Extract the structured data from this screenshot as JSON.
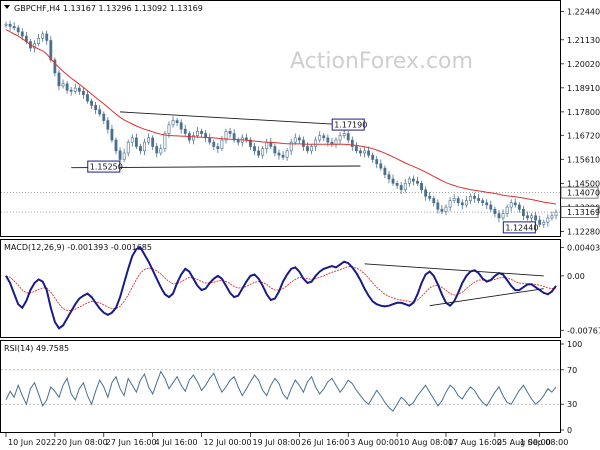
{
  "chart_data": [
    {
      "type": "candlestick",
      "title": "GBPCHF,H4  1.13167 1.13296 1.13092 1.13169",
      "watermark": "ActionForex.com",
      "y_ticks": [
        "1.22440",
        "1.21130",
        "1.20020",
        "1.18910",
        "1.17800",
        "1.16720",
        "1.15610",
        "1.14500",
        "1.13390",
        "1.12280"
      ],
      "ylim": [
        1.1225,
        1.226
      ],
      "price_tags": [
        "1.14070",
        "1.13169"
      ],
      "price_tag_values": [
        1.1407,
        1.13169
      ],
      "annotations": [
        {
          "text": "1.17190",
          "x_index": 84,
          "y": 1.1719
        },
        {
          "text": "1.15250",
          "x_index": 24,
          "y": 1.1525
        },
        {
          "text": "1.12440",
          "x_index": 126,
          "y": 1.1244
        }
      ],
      "ma_color": "#e03030",
      "candle_color": "#4a6f8f",
      "closes": [
        1.2185,
        1.2175,
        1.2168,
        1.215,
        1.213,
        1.2105,
        1.2075,
        1.2095,
        1.212,
        1.214,
        1.211,
        1.202,
        1.196,
        1.19,
        1.191,
        1.188,
        1.1875,
        1.189,
        1.1875,
        1.186,
        1.183,
        1.181,
        1.179,
        1.177,
        1.174,
        1.17,
        1.165,
        1.16,
        1.156,
        1.159,
        1.164,
        1.166,
        1.162,
        1.16,
        1.164,
        1.166,
        1.162,
        1.159,
        1.161,
        1.168,
        1.172,
        1.174,
        1.173,
        1.17,
        1.168,
        1.165,
        1.167,
        1.169,
        1.168,
        1.166,
        1.164,
        1.162,
        1.161,
        1.165,
        1.169,
        1.168,
        1.165,
        1.164,
        1.166,
        1.165,
        1.162,
        1.16,
        1.158,
        1.161,
        1.164,
        1.162,
        1.159,
        1.158,
        1.157,
        1.16,
        1.164,
        1.166,
        1.165,
        1.162,
        1.16,
        1.162,
        1.165,
        1.167,
        1.166,
        1.164,
        1.163,
        1.165,
        1.167,
        1.168,
        1.165,
        1.162,
        1.16,
        1.159,
        1.16,
        1.158,
        1.156,
        1.154,
        1.152,
        1.149,
        1.147,
        1.145,
        1.144,
        1.142,
        1.145,
        1.147,
        1.146,
        1.145,
        1.142,
        1.139,
        1.138,
        1.136,
        1.133,
        1.132,
        1.134,
        1.137,
        1.138,
        1.136,
        1.135,
        1.137,
        1.139,
        1.138,
        1.137,
        1.136,
        1.135,
        1.133,
        1.131,
        1.129,
        1.131,
        1.134,
        1.136,
        1.135,
        1.133,
        1.13,
        1.129,
        1.13,
        1.128,
        1.126,
        1.127,
        1.129,
        1.13,
        1.1317
      ],
      "ma": [
        1.216,
        1.215,
        1.214,
        1.213,
        1.2118,
        1.2105,
        1.209,
        1.208,
        1.207,
        1.2062,
        1.2048,
        1.2025,
        1.2005,
        1.1985,
        1.1968,
        1.1952,
        1.1936,
        1.1922,
        1.1908,
        1.1893,
        1.1878,
        1.1862,
        1.1847,
        1.1832,
        1.1817,
        1.1801,
        1.1785,
        1.177,
        1.1755,
        1.1743,
        1.1733,
        1.1724,
        1.1715,
        1.1707,
        1.17,
        1.1694,
        1.1688,
        1.1682,
        1.1677,
        1.1673,
        1.1671,
        1.167,
        1.1669,
        1.1668,
        1.1667,
        1.1666,
        1.1665,
        1.1664,
        1.1663,
        1.1662,
        1.1661,
        1.166,
        1.1658,
        1.1656,
        1.1655,
        1.1654,
        1.1653,
        1.1652,
        1.1651,
        1.1649,
        1.1647,
        1.1645,
        1.1643,
        1.1641,
        1.164,
        1.1639,
        1.1638,
        1.1636,
        1.1634,
        1.1633,
        1.1632,
        1.1632,
        1.1632,
        1.1631,
        1.163,
        1.163,
        1.163,
        1.163,
        1.163,
        1.163,
        1.163,
        1.163,
        1.163,
        1.163,
        1.1629,
        1.1627,
        1.1625,
        1.1622,
        1.1619,
        1.1615,
        1.161,
        1.1604,
        1.1597,
        1.1589,
        1.1581,
        1.1572,
        1.1563,
        1.1553,
        1.1544,
        1.1536,
        1.1528,
        1.152,
        1.1511,
        1.1502,
        1.1492,
        1.1482,
        1.1472,
        1.1462,
        1.1453,
        1.1446,
        1.144,
        1.1434,
        1.1429,
        1.1425,
        1.1421,
        1.1418,
        1.1415,
        1.1412,
        1.1409,
        1.1406,
        1.1403,
        1.1399,
        1.1395,
        1.1392,
        1.139,
        1.1388,
        1.1385,
        1.1382,
        1.1378,
        1.1375,
        1.1371,
        1.1367,
        1.1363,
        1.136,
        1.1357,
        1.1354
      ]
    },
    {
      "type": "macd",
      "title": "MACD(12,26,9) -0.001393 -0.001685",
      "y_ticks": [
        "0.004032",
        "0.00",
        "-0.007672"
      ],
      "ylim": [
        -0.0082,
        0.0045
      ],
      "macd": [
        0.0,
        -0.001,
        -0.0025,
        -0.004,
        -0.0045,
        -0.0035,
        -0.002,
        -0.001,
        -0.0005,
        -0.0008,
        -0.002,
        -0.0045,
        -0.0065,
        -0.0074,
        -0.007,
        -0.006,
        -0.005,
        -0.004,
        -0.0032,
        -0.0028,
        -0.0025,
        -0.003,
        -0.0038,
        -0.0046,
        -0.0052,
        -0.0055,
        -0.0052,
        -0.0045,
        -0.003,
        -0.001,
        0.001,
        0.0028,
        0.0038,
        0.004,
        0.003,
        0.002,
        0.0008,
        -0.0004,
        -0.0016,
        -0.0026,
        -0.003,
        -0.0025,
        -0.001,
        0.0002,
        0.001,
        0.0006,
        -0.0004,
        -0.0014,
        -0.002,
        -0.0018,
        -0.001,
        -0.0004,
        0.0,
        -0.0004,
        -0.0014,
        -0.0024,
        -0.003,
        -0.0028,
        -0.0018,
        -0.0008,
        0.0,
        0.0002,
        -0.0004,
        -0.0014,
        -0.0026,
        -0.0034,
        -0.0032,
        -0.0022,
        -0.0008,
        0.0002,
        0.001,
        0.0012,
        0.0006,
        -0.0004,
        -0.001,
        -0.0008,
        0.0,
        0.0006,
        0.001,
        0.0012,
        0.0014,
        0.0012,
        0.0016,
        0.002,
        0.0018,
        0.0012,
        0.0004,
        -0.0006,
        -0.0018,
        -0.0028,
        -0.0036,
        -0.004,
        -0.0042,
        -0.0043,
        -0.0042,
        -0.004,
        -0.0038,
        -0.0038,
        -0.004,
        -0.0042,
        -0.0038,
        -0.0026,
        -0.001,
        0.0002,
        0.0006,
        0.0,
        -0.0012,
        -0.0026,
        -0.0038,
        -0.0042,
        -0.0036,
        -0.0024,
        -0.001,
        0.0,
        0.0006,
        0.0008,
        0.0004,
        -0.0004,
        -0.0008,
        -0.0006,
        0.0,
        0.0004,
        0.0002,
        -0.0006,
        -0.0014,
        -0.002,
        -0.002,
        -0.0016,
        -0.0012,
        -0.0012,
        -0.0016,
        -0.002,
        -0.0024,
        -0.0026,
        -0.0022,
        -0.0014
      ],
      "signal": [
        0.0,
        -0.0002,
        -0.0007,
        -0.0013,
        -0.002,
        -0.0024,
        -0.0024,
        -0.0022,
        -0.0019,
        -0.0017,
        -0.0017,
        -0.0023,
        -0.0031,
        -0.004,
        -0.0046,
        -0.0049,
        -0.0049,
        -0.0047,
        -0.0044,
        -0.0041,
        -0.0038,
        -0.0036,
        -0.0037,
        -0.0038,
        -0.0041,
        -0.0044,
        -0.0046,
        -0.0046,
        -0.0043,
        -0.0036,
        -0.0027,
        -0.0016,
        -0.0005,
        0.0004,
        0.0009,
        0.0011,
        0.001,
        0.0007,
        0.0003,
        -0.0003,
        -0.0008,
        -0.0011,
        -0.0011,
        -0.0008,
        -0.0005,
        -0.0002,
        -0.0003,
        -0.0005,
        -0.0008,
        -0.001,
        -0.001,
        -0.0009,
        -0.0007,
        -0.0006,
        -0.0008,
        -0.0011,
        -0.0015,
        -0.0017,
        -0.0017,
        -0.0015,
        -0.0012,
        -0.0009,
        -0.0008,
        -0.0009,
        -0.0012,
        -0.0017,
        -0.002,
        -0.002,
        -0.0018,
        -0.0014,
        -0.0009,
        -0.0005,
        -0.0002,
        -0.0003,
        -0.0004,
        -0.0005,
        -0.0004,
        -0.0002,
        0.0,
        0.0003,
        0.0005,
        0.0007,
        0.0009,
        0.0011,
        0.0013,
        0.0013,
        0.0011,
        0.0008,
        0.0003,
        -0.0003,
        -0.001,
        -0.0016,
        -0.0021,
        -0.0026,
        -0.0029,
        -0.0031,
        -0.0033,
        -0.0034,
        -0.0035,
        -0.0036,
        -0.0037,
        -0.0034,
        -0.0029,
        -0.0023,
        -0.0017,
        -0.0014,
        -0.0013,
        -0.0016,
        -0.002,
        -0.0025,
        -0.0027,
        -0.0026,
        -0.0023,
        -0.0018,
        -0.0013,
        -0.0009,
        -0.0006,
        -0.0006,
        -0.0006,
        -0.0006,
        -0.0005,
        -0.0003,
        -0.0002,
        -0.0003,
        -0.0005,
        -0.0008,
        -0.001,
        -0.0011,
        -0.0011,
        -0.0011,
        -0.0012,
        -0.0013,
        -0.0015,
        -0.0017,
        -0.0018,
        -0.0017
      ]
    },
    {
      "type": "rsi",
      "title": "RSI(14) 49.7585",
      "y_ticks": [
        "100",
        "70",
        "30",
        "0"
      ],
      "ylim": [
        0,
        100
      ],
      "levels": [
        70,
        30
      ],
      "values": [
        35,
        45,
        38,
        52,
        40,
        30,
        48,
        55,
        42,
        28,
        35,
        50,
        45,
        38,
        52,
        60,
        42,
        35,
        48,
        55,
        40,
        30,
        45,
        58,
        50,
        38,
        55,
        62,
        48,
        40,
        60,
        52,
        44,
        58,
        65,
        50,
        42,
        55,
        68,
        60,
        48,
        55,
        62,
        52,
        45,
        58,
        64,
        56,
        46,
        52,
        60,
        66,
        54,
        44,
        50,
        58,
        62,
        50,
        40,
        48,
        56,
        64,
        58,
        46,
        40,
        52,
        60,
        54,
        42,
        36,
        48,
        58,
        52,
        44,
        56,
        62,
        50,
        42,
        48,
        56,
        60,
        52,
        44,
        50,
        58,
        54,
        46,
        40,
        34,
        30,
        38,
        46,
        40,
        32,
        26,
        22,
        30,
        38,
        34,
        28,
        32,
        40,
        46,
        52,
        44,
        36,
        28,
        34,
        44,
        52,
        48,
        40,
        36,
        44,
        50,
        46,
        38,
        32,
        28,
        36,
        44,
        50,
        40,
        32,
        30,
        38,
        46,
        52,
        44,
        36,
        30,
        34,
        40,
        48,
        44,
        50
      ]
    }
  ],
  "x_axis": {
    "labels": [
      "10 Jun 2022",
      "20 Jun 08:00",
      "27 Jun 16:00",
      "4 Jul 16:00",
      "12 Jul 00:00",
      "19 Jul 08:00",
      "26 Jul 16:00",
      "3 Aug 00:00",
      "10 Aug 08:00",
      "17 Aug 16:00",
      "25 Aug 00:00",
      "1 Sep 08:00"
    ],
    "label_indices": [
      0,
      12,
      24,
      36,
      48,
      60,
      72,
      84,
      96,
      108,
      120,
      131
    ]
  },
  "colors": {
    "background": "#ffffff",
    "axis": "#000000",
    "trendline": "#1a1a1a",
    "macd": "#1a1a8a",
    "signal": "#e03030",
    "rsi": "#4a6f8f",
    "grid": "#9a9a9a"
  }
}
